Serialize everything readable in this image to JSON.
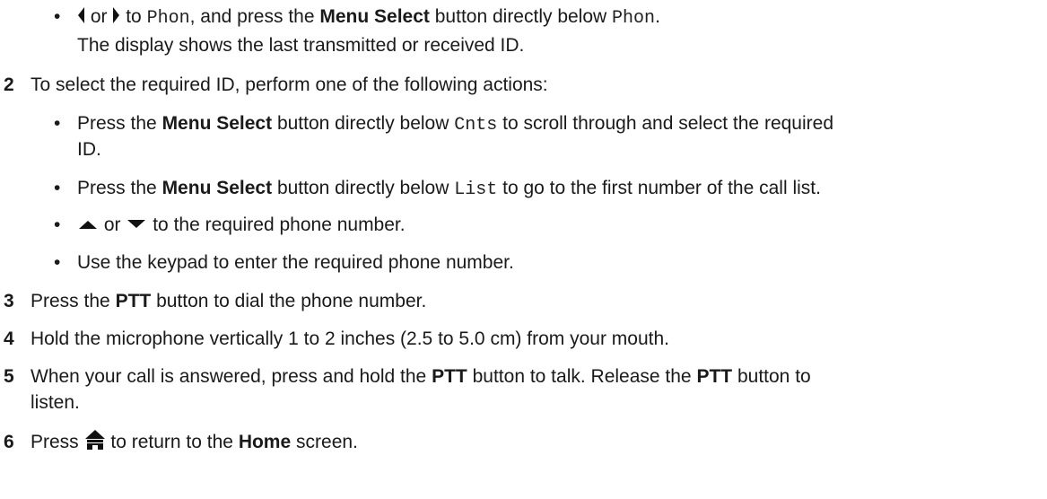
{
  "step1_cont": {
    "bullet": "•",
    "or": "or",
    "to": "to",
    "phon": "Phon",
    "mid": ", and press the",
    "menu_select": "Menu Select",
    "directly_below": "button directly below",
    "phon2": "Phon",
    "period": ".",
    "display_line": "The display shows the last transmitted or received ID."
  },
  "step2": {
    "num": "2",
    "text": "To select the required ID, perform one of the following actions:",
    "opt1": {
      "bullet": "•",
      "press": "Press the",
      "menu_select": "Menu Select",
      "below": "button directly below",
      "code": "Cnts",
      "rest": "to scroll through and select the required",
      "wrap": "ID."
    },
    "opt2": {
      "bullet": "•",
      "press": "Press the",
      "menu_select": "Menu Select",
      "below": "button directly below",
      "code": "List",
      "rest": "to go to the first number of the call list."
    },
    "opt3": {
      "bullet": "•",
      "or": "or",
      "rest": "to the required phone number."
    },
    "opt4": {
      "bullet": "•",
      "text": "Use the keypad to enter the required phone number."
    }
  },
  "step3": {
    "num": "3",
    "pre": "Press the",
    "ptt": "PTT",
    "post": "button to dial the phone number."
  },
  "step4": {
    "num": "4",
    "text": "Hold the microphone vertically 1 to 2 inches (2.5 to 5.0 cm) from your mouth."
  },
  "step5": {
    "num": "5",
    "pre": "When your call is answered, press and hold the",
    "ptt": "PTT",
    "mid": "button to talk. Release the",
    "ptt2": "PTT",
    "post": "button to",
    "wrap": "listen."
  },
  "step6": {
    "num": "6",
    "pre": "Press",
    "mid": "to return to the",
    "home": "Home",
    "post": "screen."
  },
  "icons": {
    "left": "left-arrow-icon",
    "right": "right-arrow-icon",
    "up": "up-arrow-icon",
    "down": "down-arrow-icon",
    "home": "home-icon"
  }
}
